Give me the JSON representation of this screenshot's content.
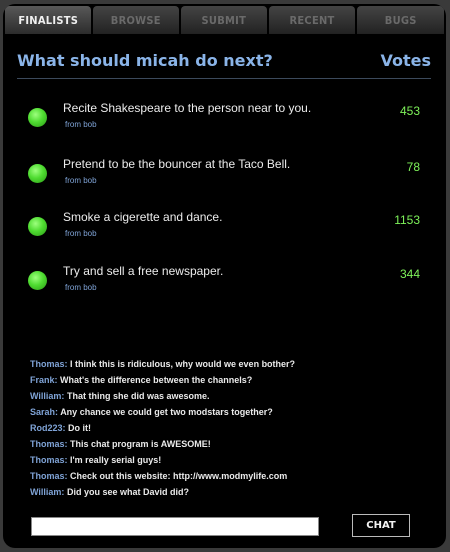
{
  "tabs": [
    {
      "label": "FINALISTS",
      "active": true
    },
    {
      "label": "BROWSE",
      "active": false
    },
    {
      "label": "SUBMIT",
      "active": false
    },
    {
      "label": "RECENT",
      "active": false
    },
    {
      "label": "BUGS",
      "active": false
    }
  ],
  "poll": {
    "question": "What should micah do next?",
    "votes_header": "Votes",
    "options": [
      {
        "text": "Recite Shakespeare to the person near to you.",
        "from": "from bob",
        "votes": "453"
      },
      {
        "text": "Pretend to be the bouncer at the Taco Bell.",
        "from": "from bob",
        "votes": "78"
      },
      {
        "text": "Smoke a cigerette and dance.",
        "from": "from bob",
        "votes": "1153"
      },
      {
        "text": "Try and sell a free newspaper.",
        "from": "from bob",
        "votes": "344"
      }
    ]
  },
  "chat": {
    "messages": [
      {
        "user": "Thomas:",
        "text": "I think this is ridiculous, why would we even bother?"
      },
      {
        "user": "Frank:",
        "text": "What's the difference between the channels?"
      },
      {
        "user": "William:",
        "text": "That thing she did was awesome."
      },
      {
        "user": "Sarah:",
        "text": "Any chance we could get two modstars together?"
      },
      {
        "user": "Rod223:",
        "text": "Do it!"
      },
      {
        "user": "Thomas:",
        "text": "This chat program is AWESOME!"
      },
      {
        "user": "Thomas:",
        "text": "I'm really serial guys!"
      },
      {
        "user": "Thomas:",
        "text": "Check out this website: http://www.modmylife.com"
      },
      {
        "user": "William:",
        "text": "Did you see what David did?"
      }
    ],
    "input_value": "",
    "button_label": "CHAT"
  },
  "colors": {
    "accent_blue": "#8ab4e8",
    "vote_green": "#7ef25a",
    "dot_green": "#4fdc31"
  }
}
